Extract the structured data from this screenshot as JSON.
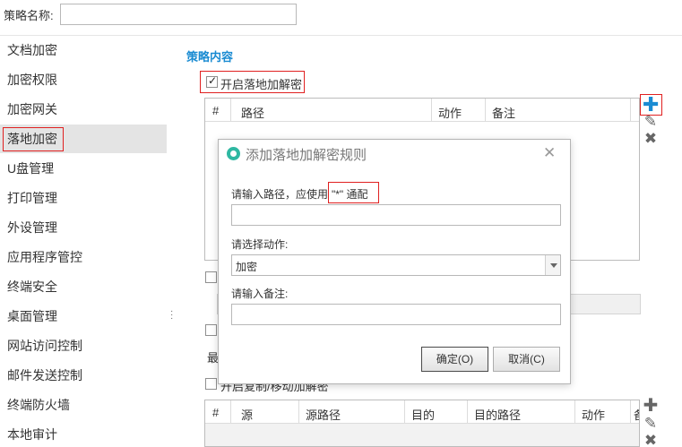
{
  "topbar": {
    "label": "策略名称:",
    "name_value": ""
  },
  "sidebar": {
    "items": [
      {
        "label": "文档加密"
      },
      {
        "label": "加密权限"
      },
      {
        "label": "加密网关"
      },
      {
        "label": "落地加密"
      },
      {
        "label": "U盘管理"
      },
      {
        "label": "打印管理"
      },
      {
        "label": "外设管理"
      },
      {
        "label": "应用程序管控"
      },
      {
        "label": "终端安全"
      },
      {
        "label": "桌面管理"
      },
      {
        "label": "网站访问控制"
      },
      {
        "label": "邮件发送控制"
      },
      {
        "label": "终端防火墙"
      },
      {
        "label": "本地审计"
      }
    ],
    "active_index": 3
  },
  "main": {
    "section_title": "策略内容",
    "enable_checkbox_label": "开启落地加解密",
    "enable_checked": true,
    "table1": {
      "columns": [
        "#",
        "路径",
        "动作",
        "备注"
      ]
    },
    "partial_label_1": "最",
    "partial_label_2": "开启复制/移动加解密",
    "table2": {
      "columns": [
        "#",
        "源",
        "源路径",
        "目的",
        "目的路径",
        "动作",
        "备"
      ]
    }
  },
  "toolbar": {
    "add_icon": "plus-icon",
    "edit_icon": "pencil-icon",
    "delete_icon": "x-icon"
  },
  "dialog": {
    "title": "添加落地加解密规则",
    "path_label": "请输入路径，应使用",
    "wildcard_text": "\"*\" 通配",
    "path_value": "",
    "action_label": "请选择动作:",
    "action_value": "加密",
    "note_label": "请输入备注:",
    "note_value": "",
    "ok_label": "确定(O)",
    "cancel_label": "取消(C)"
  },
  "colors": {
    "accent": "#1a8bd2",
    "highlight": "#e02020",
    "logo": "#2fb8a2"
  }
}
